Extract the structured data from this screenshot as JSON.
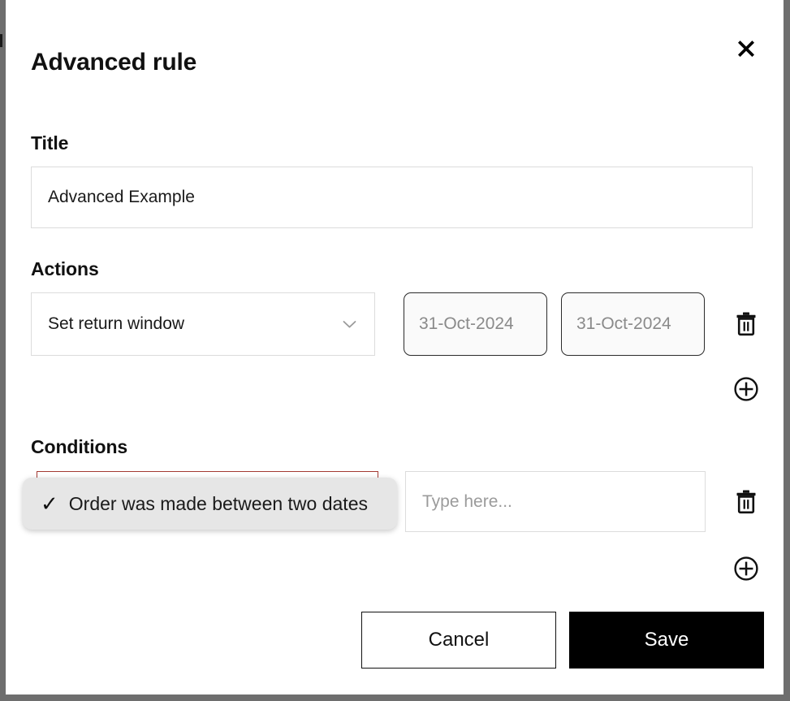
{
  "modal": {
    "title": "Advanced rule",
    "close_icon": "close-x-icon"
  },
  "title_section": {
    "label": "Title",
    "value": "Advanced Example",
    "placeholder": ""
  },
  "actions_section": {
    "label": "Actions",
    "action_select": {
      "selected": "Set return window",
      "chevron_icon": "chevron-down-icon"
    },
    "date_from": {
      "value": "",
      "placeholder": "31-Oct-2024"
    },
    "date_to": {
      "value": "",
      "placeholder": "31-Oct-2024"
    },
    "delete_icon": "trash-icon",
    "add_icon": "plus-circle-icon"
  },
  "conditions_section": {
    "label": "Conditions",
    "dropdown_open_option": {
      "check_glyph": "✓",
      "label": "Order was made between two dates"
    },
    "value_input": {
      "value": "",
      "placeholder": "Type here..."
    },
    "delete_icon": "trash-icon",
    "add_icon": "plus-circle-icon"
  },
  "footer": {
    "cancel_label": "Cancel",
    "save_label": "Save"
  },
  "colors": {
    "backdrop": "#6e6e6e",
    "error_border": "#a33a33",
    "save_bg": "#000000",
    "dropdown_bg": "#e6e6e6"
  }
}
